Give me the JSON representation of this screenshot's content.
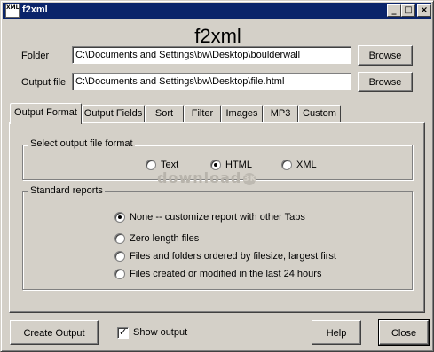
{
  "window": {
    "title": "f2xml",
    "icon_text": "XML",
    "controls": {
      "minimize": "_",
      "maximize": "□",
      "close": "×"
    }
  },
  "heading": "f2xml",
  "folder": {
    "label": "Folder",
    "value": "C:\\Documents and Settings\\bw\\Desktop\\boulderwall",
    "browse_label": "Browse"
  },
  "output_file": {
    "label": "Output file",
    "value": "C:\\Documents and Settings\\bw\\Desktop\\file.html",
    "browse_label": "Browse"
  },
  "tabs": [
    {
      "label": "Output Format",
      "active": true
    },
    {
      "label": "Output Fields",
      "active": false
    },
    {
      "label": "Sort",
      "active": false
    },
    {
      "label": "Filter",
      "active": false
    },
    {
      "label": "Images",
      "active": false
    },
    {
      "label": "MP3",
      "active": false
    },
    {
      "label": "Custom",
      "active": false
    }
  ],
  "format_group": {
    "title": "Select output file format",
    "options": [
      {
        "label": "Text",
        "checked": false
      },
      {
        "label": "HTML",
        "checked": true
      },
      {
        "label": "XML",
        "checked": false
      }
    ]
  },
  "reports_group": {
    "title": "Standard reports",
    "options": [
      {
        "label": "None -- customize report with other Tabs",
        "checked": true
      },
      {
        "label": "Zero length files",
        "checked": false
      },
      {
        "label": "Files and folders ordered by filesize, largest first",
        "checked": false
      },
      {
        "label": "Files created or modified in the last 24 hours",
        "checked": false
      }
    ]
  },
  "watermark": {
    "text": "download",
    "badge": "3K"
  },
  "footer": {
    "create_output_label": "Create Output",
    "show_output": {
      "label": "Show output",
      "checked": true
    },
    "help_label": "Help",
    "close_label": "Close"
  }
}
